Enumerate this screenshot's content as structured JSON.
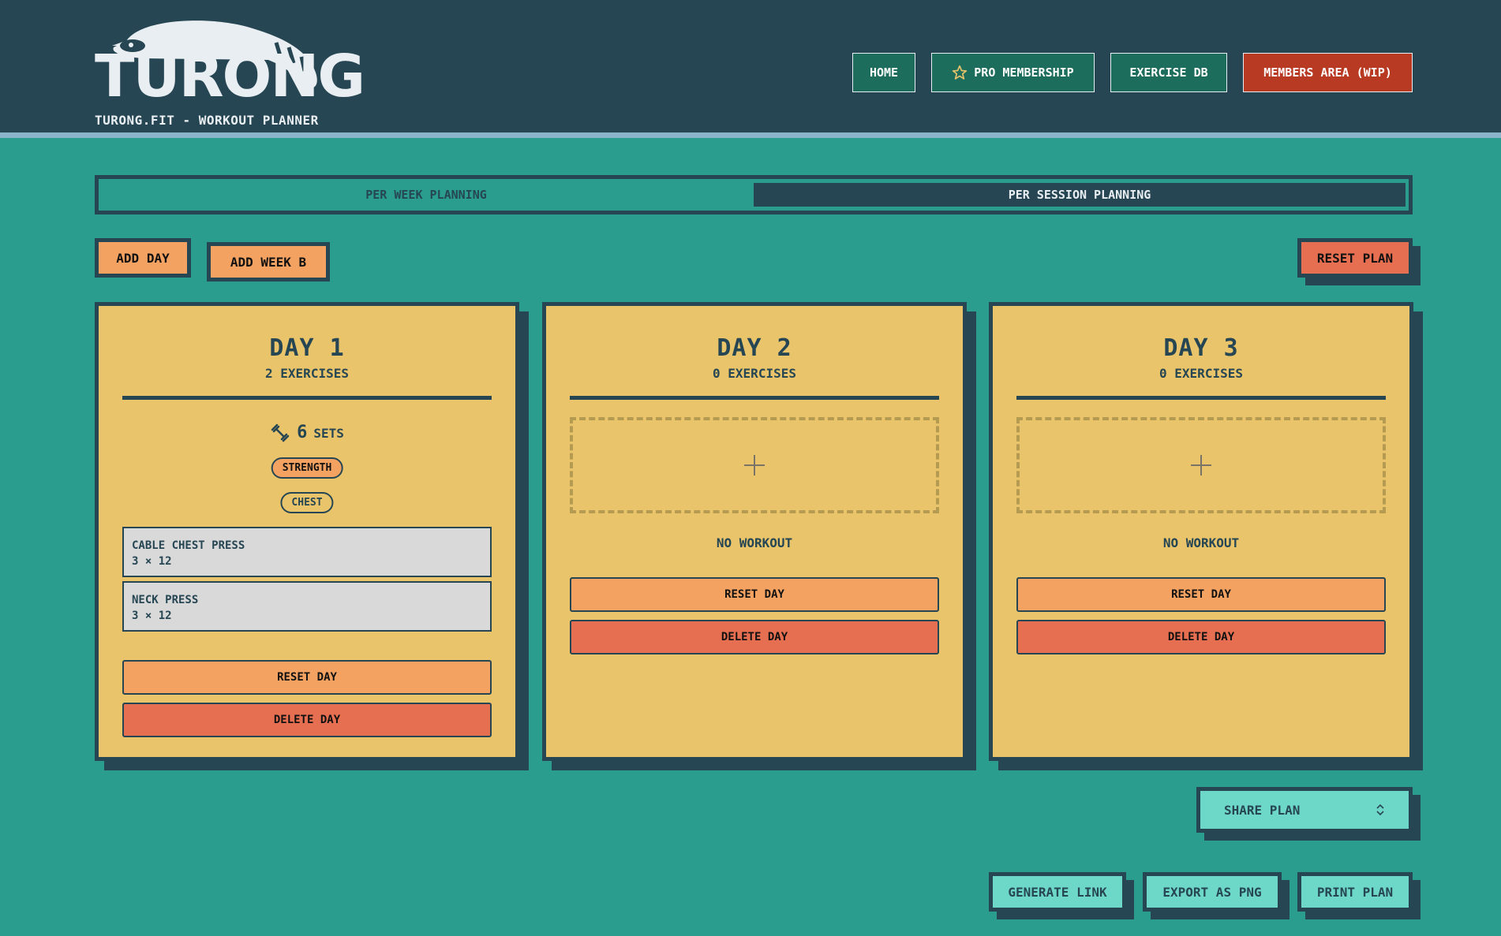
{
  "header": {
    "logo_text": "TURONG",
    "tagline": "TURONG.FIT - WORKOUT PLANNER",
    "nav": {
      "home": "HOME",
      "pro": "PRO MEMBERSHIP",
      "exercise_db": "EXERCISE DB",
      "members": "MEMBERS AREA (WIP)"
    }
  },
  "planning_toggle": {
    "per_week": "PER WEEK PLANNING",
    "per_session": "PER SESSION PLANNING",
    "selected": "PER SESSION PLANNING"
  },
  "actions": {
    "add_day": "ADD DAY",
    "add_week_b": "ADD WEEK B",
    "reset_plan": "RESET PLAN"
  },
  "days": [
    {
      "title": "DAY 1",
      "subtitle": "2 EXERCISES",
      "sets_count": "6",
      "sets_label": "SETS",
      "tags": [
        "STRENGTH",
        "CHEST"
      ],
      "exercises": [
        {
          "name": "CABLE CHEST PRESS",
          "reps": "3 × 12"
        },
        {
          "name": "NECK PRESS",
          "reps": "3 × 12"
        }
      ],
      "reset_label": "RESET DAY",
      "delete_label": "DELETE DAY"
    },
    {
      "title": "DAY 2",
      "subtitle": "0 EXERCISES",
      "empty_label": "NO WORKOUT",
      "reset_label": "RESET DAY",
      "delete_label": "DELETE DAY"
    },
    {
      "title": "DAY 3",
      "subtitle": "0 EXERCISES",
      "empty_label": "NO WORKOUT",
      "reset_label": "RESET DAY",
      "delete_label": "DELETE DAY"
    }
  ],
  "share": {
    "select_label": "SHARE PLAN",
    "generate_link": "GENERATE LINK",
    "export_png": "EXPORT AS PNG",
    "print_plan": "PRINT PLAN"
  },
  "colors": {
    "background": "#2a9d8f",
    "header": "#264653",
    "card": "#e9c46a",
    "orange": "#f4a261",
    "coral": "#e76f51",
    "teal_button": "#6ed8c8",
    "members_red": "#b83a22"
  },
  "icons": {
    "logo": "raccoon-logo",
    "pro": "star-icon",
    "sets": "dumbbell-icon",
    "add": "plus-icon",
    "select": "chevron-updown-icon"
  }
}
